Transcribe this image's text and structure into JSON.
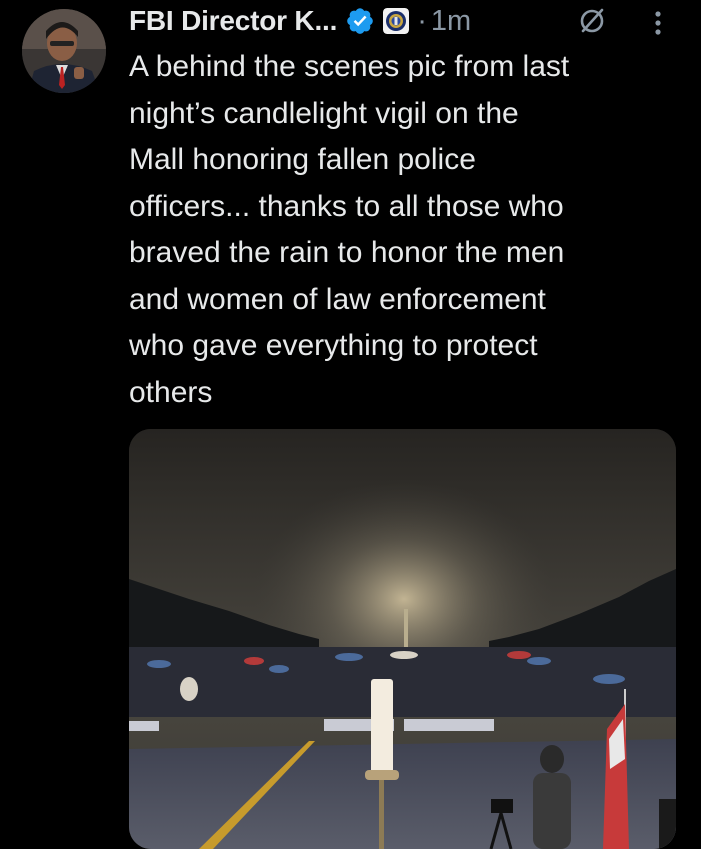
{
  "tweet": {
    "author_name": "FBI Director K...",
    "separator": "·",
    "time": "1m",
    "text": "A behind the scenes pic from last\nnight’s candlelight vigil on the\nMall honoring fallen police\nofficers... thanks to all those who\nbraved the rain to honor the men\nand women of law enforcement\nwho gave everything to protect\nothers"
  },
  "icons": {
    "verified": "verified-badge-icon",
    "affiliation": "fbi-seal-icon",
    "grok": "grok-icon",
    "more": "more-options-icon"
  },
  "colors": {
    "background": "#000000",
    "text": "#e7e9ea",
    "muted": "#8b98a5",
    "verified_blue": "#1d9bf0"
  }
}
